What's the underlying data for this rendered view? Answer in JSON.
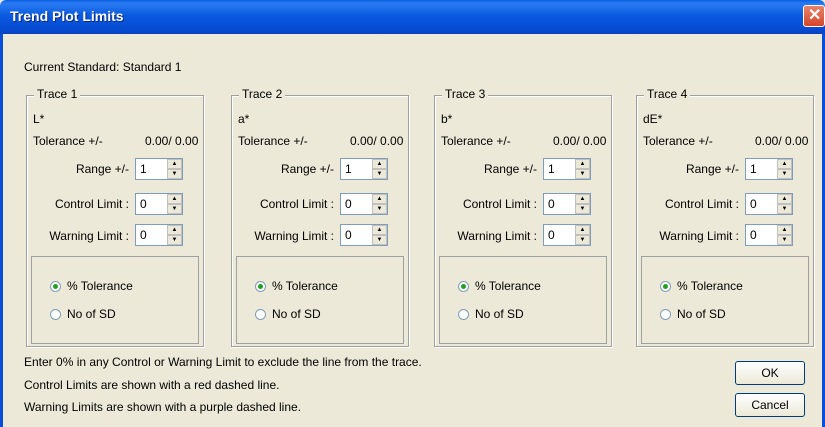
{
  "window": {
    "title": "Trend Plot Limits"
  },
  "current_standard": {
    "label": "Current Standard:",
    "value": "Standard 1"
  },
  "traces": [
    {
      "name": "Trace 1",
      "code": "L*",
      "tolerance_label": "Tolerance +/-",
      "tolerance_value": "0.00/ 0.00",
      "range_label": "Range +/-",
      "range": "1",
      "control_label": "Control Limit :",
      "control": "0",
      "warning_label": "Warning Limit :",
      "warning": "0",
      "opt_tol": "% Tolerance",
      "opt_sd": "No of SD",
      "selected": "tolerance"
    },
    {
      "name": "Trace 2",
      "code": "a*",
      "tolerance_label": "Tolerance +/-",
      "tolerance_value": "0.00/ 0.00",
      "range_label": "Range +/-",
      "range": "1",
      "control_label": "Control Limit :",
      "control": "0",
      "warning_label": "Warning Limit :",
      "warning": "0",
      "opt_tol": "% Tolerance",
      "opt_sd": "No of SD",
      "selected": "tolerance"
    },
    {
      "name": "Trace 3",
      "code": "b*",
      "tolerance_label": "Tolerance +/-",
      "tolerance_value": "0.00/ 0.00",
      "range_label": "Range +/-",
      "range": "1",
      "control_label": "Control Limit :",
      "control": "0",
      "warning_label": "Warning Limit :",
      "warning": "0",
      "opt_tol": "% Tolerance",
      "opt_sd": "No of SD",
      "selected": "tolerance"
    },
    {
      "name": "Trace 4",
      "code": "dE*",
      "tolerance_label": "Tolerance +/-",
      "tolerance_value": "0.00/ 0.00",
      "range_label": "Range +/-",
      "range": "1",
      "control_label": "Control Limit :",
      "control": "0",
      "warning_label": "Warning Limit :",
      "warning": "0",
      "opt_tol": "% Tolerance",
      "opt_sd": "No of SD",
      "selected": "tolerance"
    }
  ],
  "info": [
    "Enter 0% in any Control or Warning Limit to exclude the line from the trace.",
    "Control Limits are shown with a red dashed line.",
    "Warning Limits are shown with a purple dashed line."
  ],
  "buttons": {
    "ok": "OK",
    "cancel": "Cancel"
  }
}
